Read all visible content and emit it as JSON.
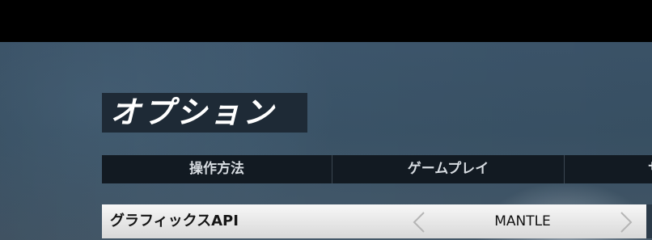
{
  "screen": {
    "title": "オプション"
  },
  "tabs": [
    {
      "label": "操作方法"
    },
    {
      "label": "ゲームプレイ"
    },
    {
      "label": "サ"
    }
  ],
  "setting": {
    "label": "グラフィックスAPI",
    "value": "MANTLE"
  },
  "icons": {
    "prev": "chevron-left-icon",
    "next": "chevron-right-icon"
  },
  "colors": {
    "title_bg": "#1e2a36",
    "tab_bar_bg": "#121a22",
    "row_bg": "#e6e6e6"
  }
}
